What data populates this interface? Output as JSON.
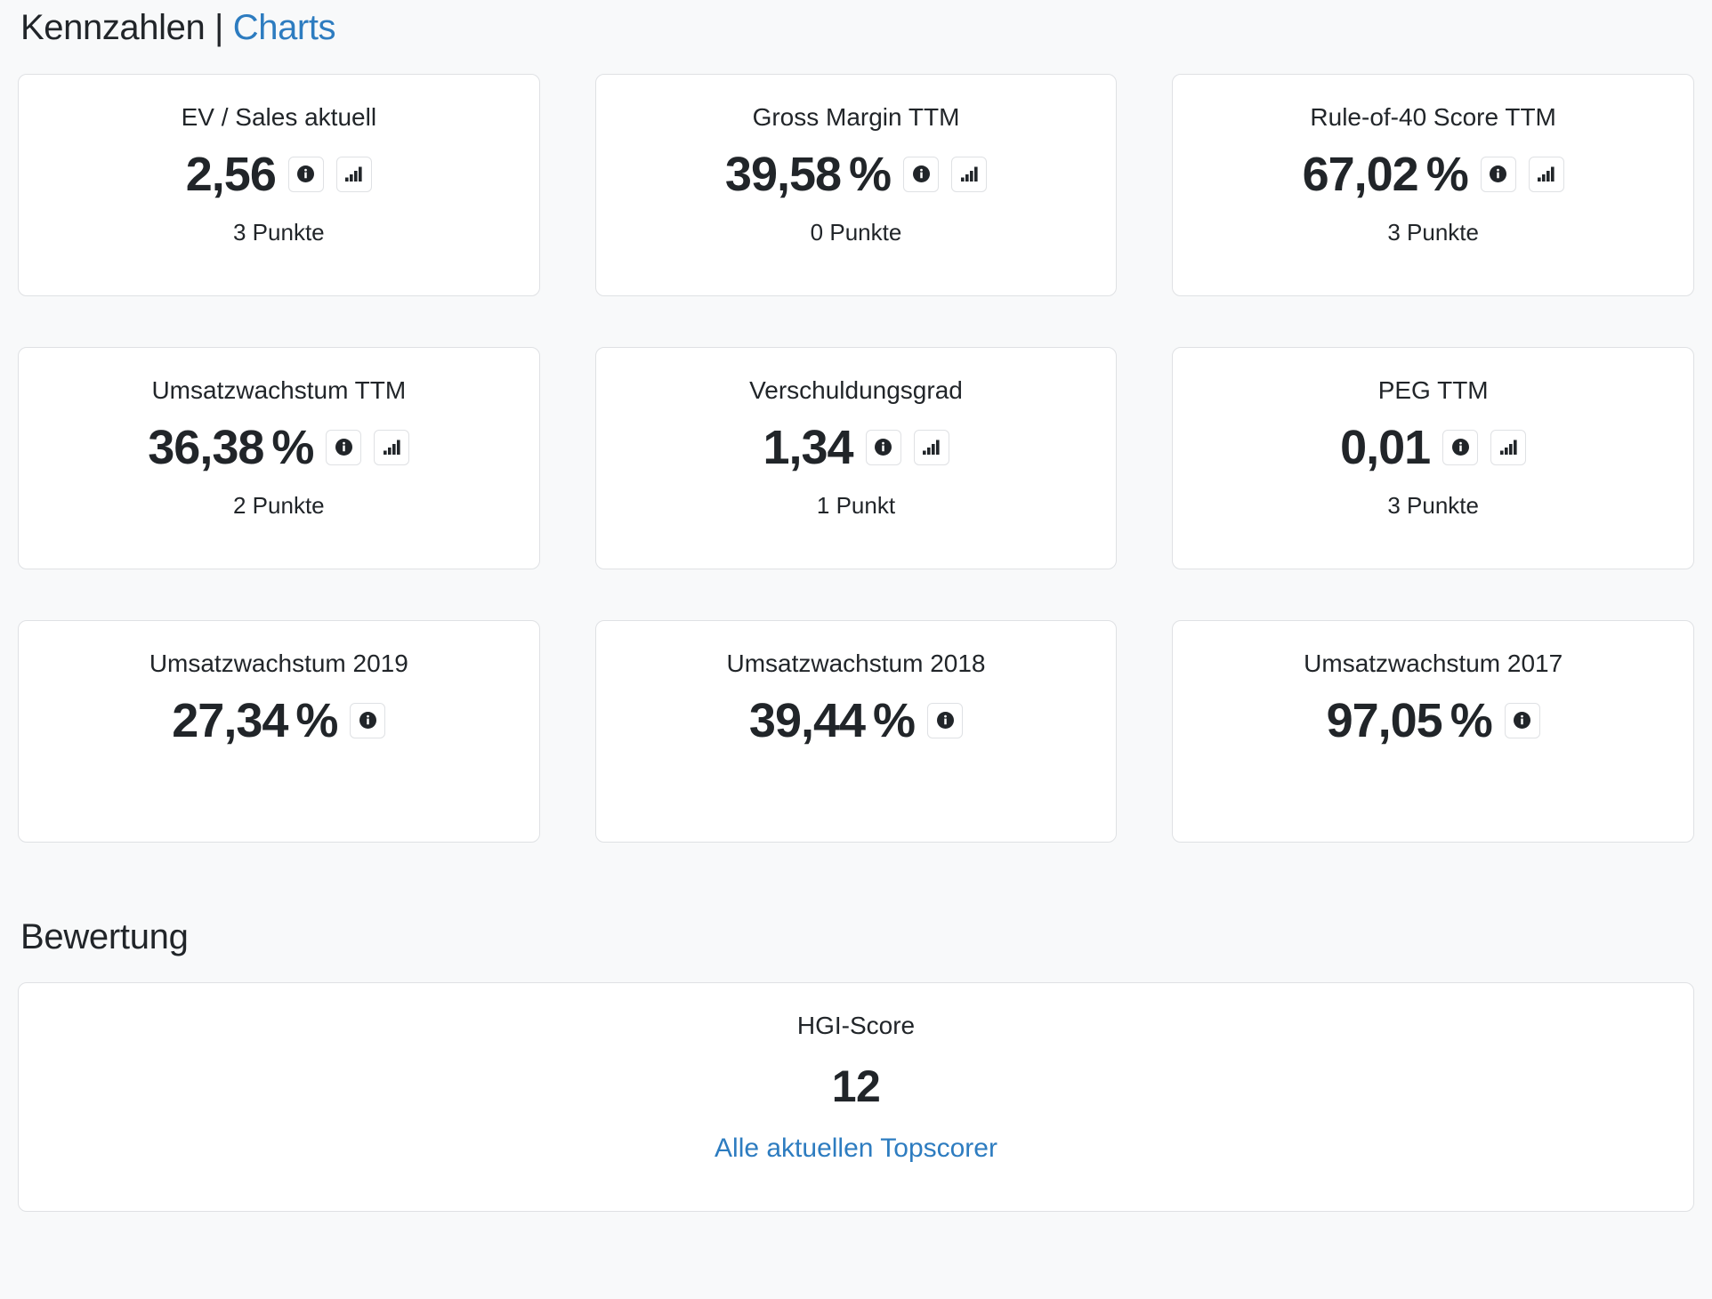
{
  "header": {
    "title_main": "Kennzahlen",
    "separator": "|",
    "title_link": "Charts"
  },
  "metrics": [
    {
      "title": "EV / Sales aktuell",
      "value": "2,56",
      "unit": "",
      "points": "3 Punkte",
      "info_icon": "info-circle-icon",
      "chart_icon": "bar-chart-icon",
      "has_chart": true
    },
    {
      "title": "Gross Margin TTM",
      "value": "39,58",
      "unit": "%",
      "points": "0 Punkte",
      "info_icon": "info-circle-icon",
      "chart_icon": "bar-chart-icon",
      "has_chart": true
    },
    {
      "title": "Rule-of-40 Score TTM",
      "value": "67,02",
      "unit": "%",
      "points": "3 Punkte",
      "info_icon": "info-circle-icon",
      "chart_icon": "bar-chart-icon",
      "has_chart": true
    },
    {
      "title": "Umsatzwachstum TTM",
      "value": "36,38",
      "unit": "%",
      "points": "2 Punkte",
      "info_icon": "info-circle-icon",
      "chart_icon": "bar-chart-icon",
      "has_chart": true
    },
    {
      "title": "Verschuldungsgrad",
      "value": "1,34",
      "unit": "",
      "points": "1 Punkt",
      "info_icon": "info-circle-icon",
      "chart_icon": "bar-chart-icon",
      "has_chart": true
    },
    {
      "title": "PEG TTM",
      "value": "0,01",
      "unit": "",
      "points": "3 Punkte",
      "info_icon": "info-circle-icon",
      "chart_icon": "bar-chart-icon",
      "has_chart": true
    },
    {
      "title": "Umsatzwachstum 2019",
      "value": "27,34",
      "unit": "%",
      "points": "",
      "info_icon": "info-circle-icon",
      "chart_icon": "",
      "has_chart": false
    },
    {
      "title": "Umsatzwachstum 2018",
      "value": "39,44",
      "unit": "%",
      "points": "",
      "info_icon": "info-circle-icon",
      "chart_icon": "",
      "has_chart": false
    },
    {
      "title": "Umsatzwachstum 2017",
      "value": "97,05",
      "unit": "%",
      "points": "",
      "info_icon": "info-circle-icon",
      "chart_icon": "",
      "has_chart": false
    }
  ],
  "bewertung": {
    "heading": "Bewertung",
    "score_label": "HGI-Score",
    "score_value": "12",
    "link_label": "Alle aktuellen Topscorer"
  },
  "colors": {
    "page_background": "#f8f9fa",
    "card_background": "#ffffff",
    "card_border": "#dfe1e4",
    "text": "#212529",
    "link": "#2d7cc0"
  }
}
